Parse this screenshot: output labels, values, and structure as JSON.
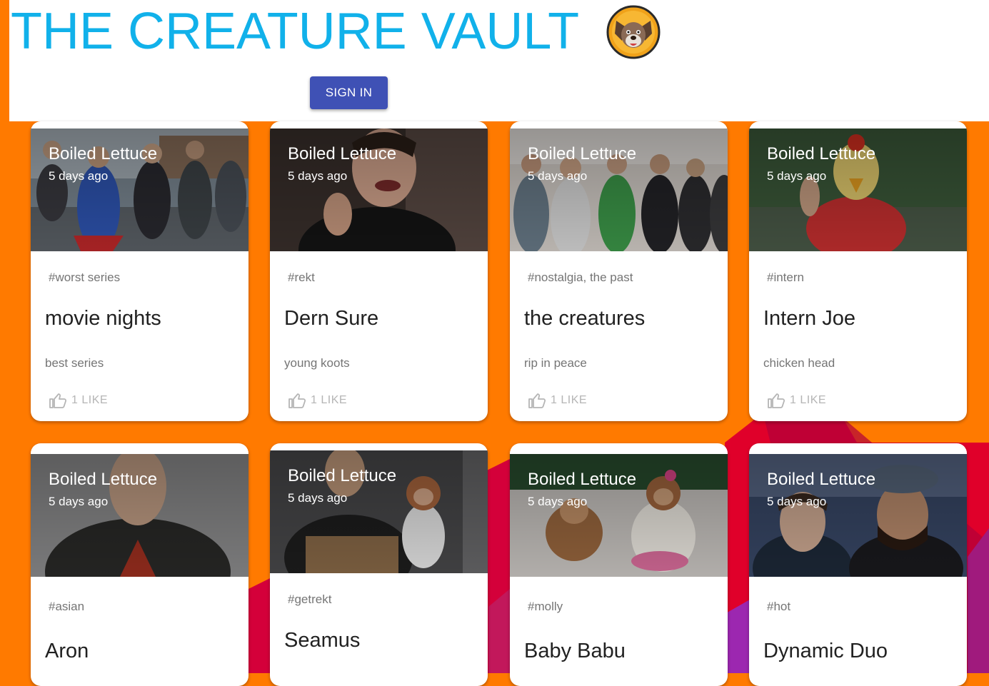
{
  "header": {
    "title": "THE CREATURE VAULT",
    "logo_icon": "creature-dog-logo",
    "signin_label": "SIGN IN"
  },
  "colors": {
    "title": "#11b1ea",
    "button": "#3f51b5",
    "background": "#ff7a00"
  },
  "cards": [
    {
      "author": "Boiled Lettuce",
      "time": "5 days ago",
      "tag": "#worst series",
      "title": "movie nights",
      "desc": "best series",
      "likes": "1 LIKE"
    },
    {
      "author": "Boiled Lettuce",
      "time": "5 days ago",
      "tag": "#rekt",
      "title": "Dern Sure",
      "desc": "young koots",
      "likes": "1 LIKE"
    },
    {
      "author": "Boiled Lettuce",
      "time": "5 days ago",
      "tag": "#nostalgia, the past",
      "title": "the creatures",
      "desc": "rip in peace",
      "likes": "1 LIKE"
    },
    {
      "author": "Boiled Lettuce",
      "time": "5 days ago",
      "tag": "#intern",
      "title": "Intern Joe",
      "desc": "chicken head",
      "likes": "1 LIKE"
    },
    {
      "author": "Boiled Lettuce",
      "time": "5 days ago",
      "tag": "#asian",
      "title": "Aron"
    },
    {
      "author": "Boiled Lettuce",
      "time": "5 days ago",
      "tag": "#getrekt",
      "title": "Seamus"
    },
    {
      "author": "Boiled Lettuce",
      "time": "5 days ago",
      "tag": "#molly",
      "title": "Baby Babu"
    },
    {
      "author": "Boiled Lettuce",
      "time": "5 days ago",
      "tag": "#hot",
      "title": "Dynamic Duo"
    }
  ]
}
